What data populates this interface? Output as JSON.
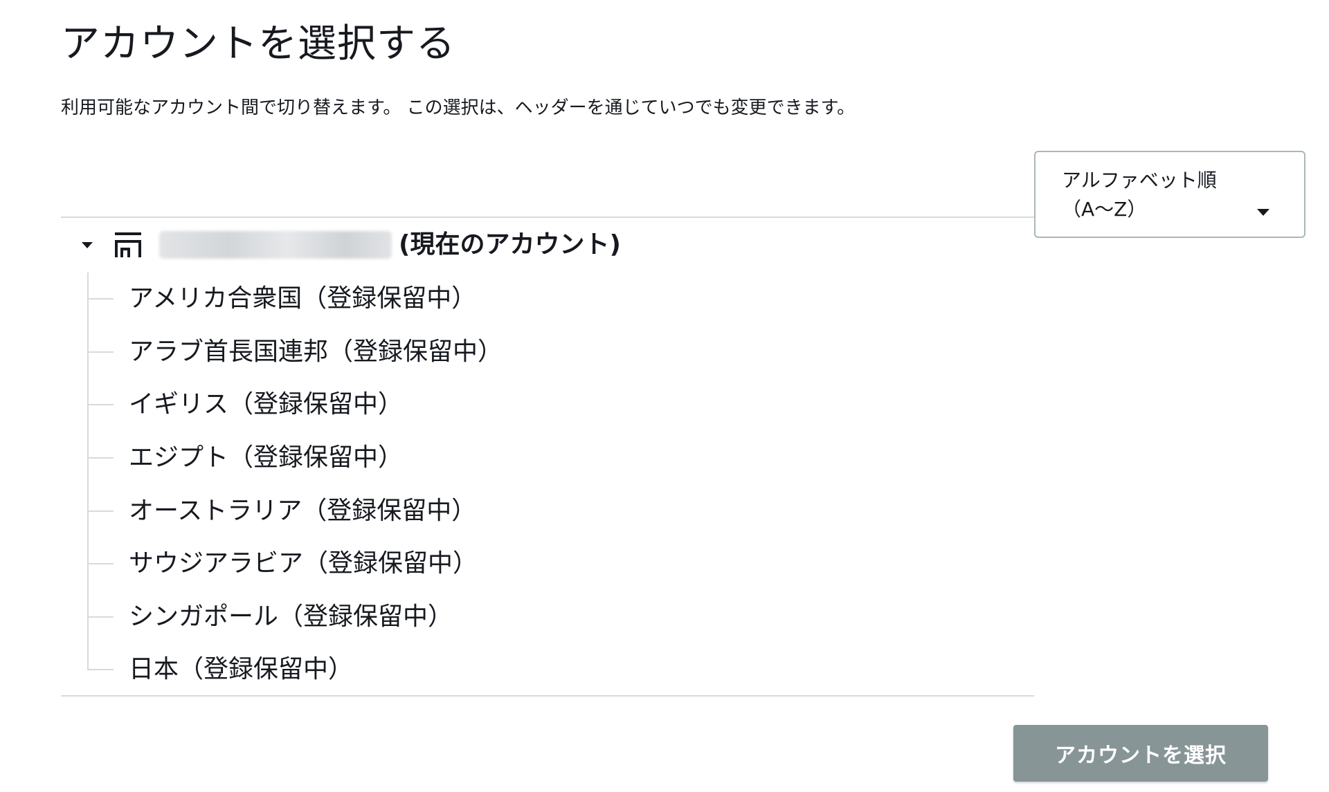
{
  "header": {
    "title": "アカウントを選択する",
    "description": "利用可能なアカウント間で切り替えます。 この選択は、ヘッダーを通じていつでも変更できます。"
  },
  "sort": {
    "selected_label": "アルファベット順（A〜Z）",
    "caret_icon": "caret-down-icon"
  },
  "tree": {
    "root": {
      "icon": "building-icon",
      "account_id": "[blurred account ID]",
      "current_label": "(現在のアカウント)",
      "expanded": true
    },
    "children": [
      {
        "label": "アメリカ合衆国（登録保留中）"
      },
      {
        "label": "アラブ首長国連邦（登録保留中）"
      },
      {
        "label": "イギリス（登録保留中）"
      },
      {
        "label": "エジプト（登録保留中）"
      },
      {
        "label": "オーストラリア（登録保留中）"
      },
      {
        "label": "サウジアラビア（登録保留中）"
      },
      {
        "label": "シンガポール（登録保留中）"
      },
      {
        "label": "日本（登録保留中）"
      }
    ]
  },
  "footer": {
    "select_button_label": "アカウントを選択",
    "select_button_disabled": true
  },
  "colors": {
    "text": "#16191f",
    "divider": "#d5dbdb",
    "button_disabled_bg": "#879596",
    "select_border": "#aab7b8"
  }
}
